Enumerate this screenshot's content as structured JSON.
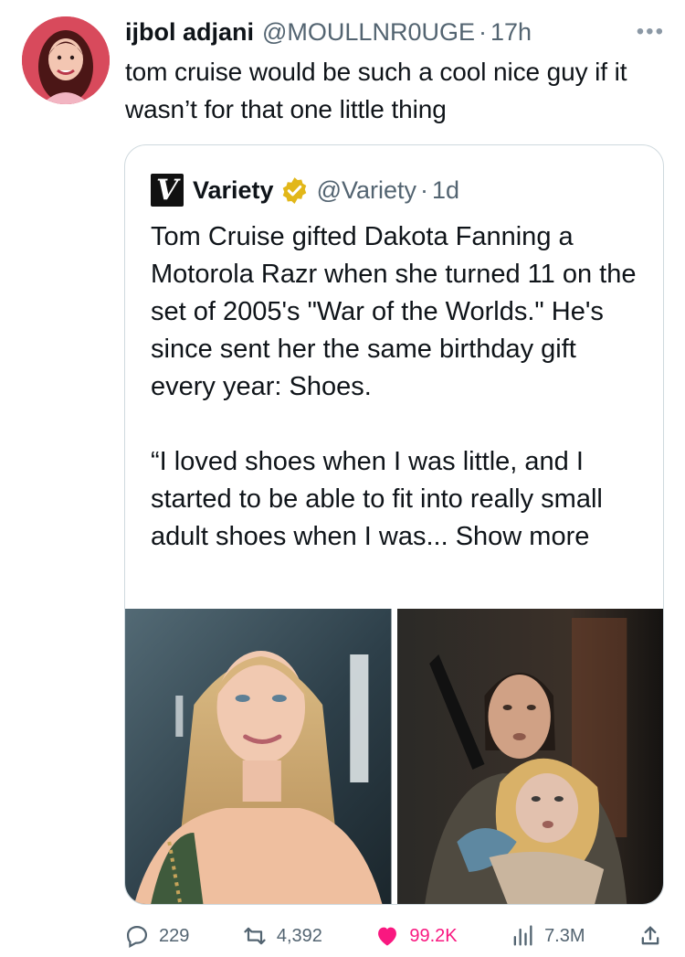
{
  "author": {
    "name": "ijbol adjani",
    "handle": "@MOULLNR0UGE",
    "separator": "·",
    "time": "17h",
    "text": "tom cruise would be such a cool nice guy if it wasn’t for that one little thing",
    "more_icon": "more-horizontal-icon"
  },
  "quote": {
    "logo_letter": "V",
    "name": "Variety",
    "handle": "@Variety",
    "separator": "·",
    "time": "1d",
    "paragraph_1": "Tom Cruise gifted Dakota Fanning a Motorola Razr when she turned 11 on the set of 2005's \"War of the Worlds.\" He's since sent her the same birthday gift every year: Shoes.",
    "paragraph_2": "“I loved shoes when I was little, and I started to be able to fit into really small adult shoes when I was...",
    "show_more": "Show more"
  },
  "metrics": {
    "replies": "229",
    "retweets": "4,392",
    "likes": "99.2K",
    "views": "7.3M"
  },
  "colors": {
    "like": "#f91880",
    "muted": "#536471",
    "verified": "#e2b719"
  }
}
